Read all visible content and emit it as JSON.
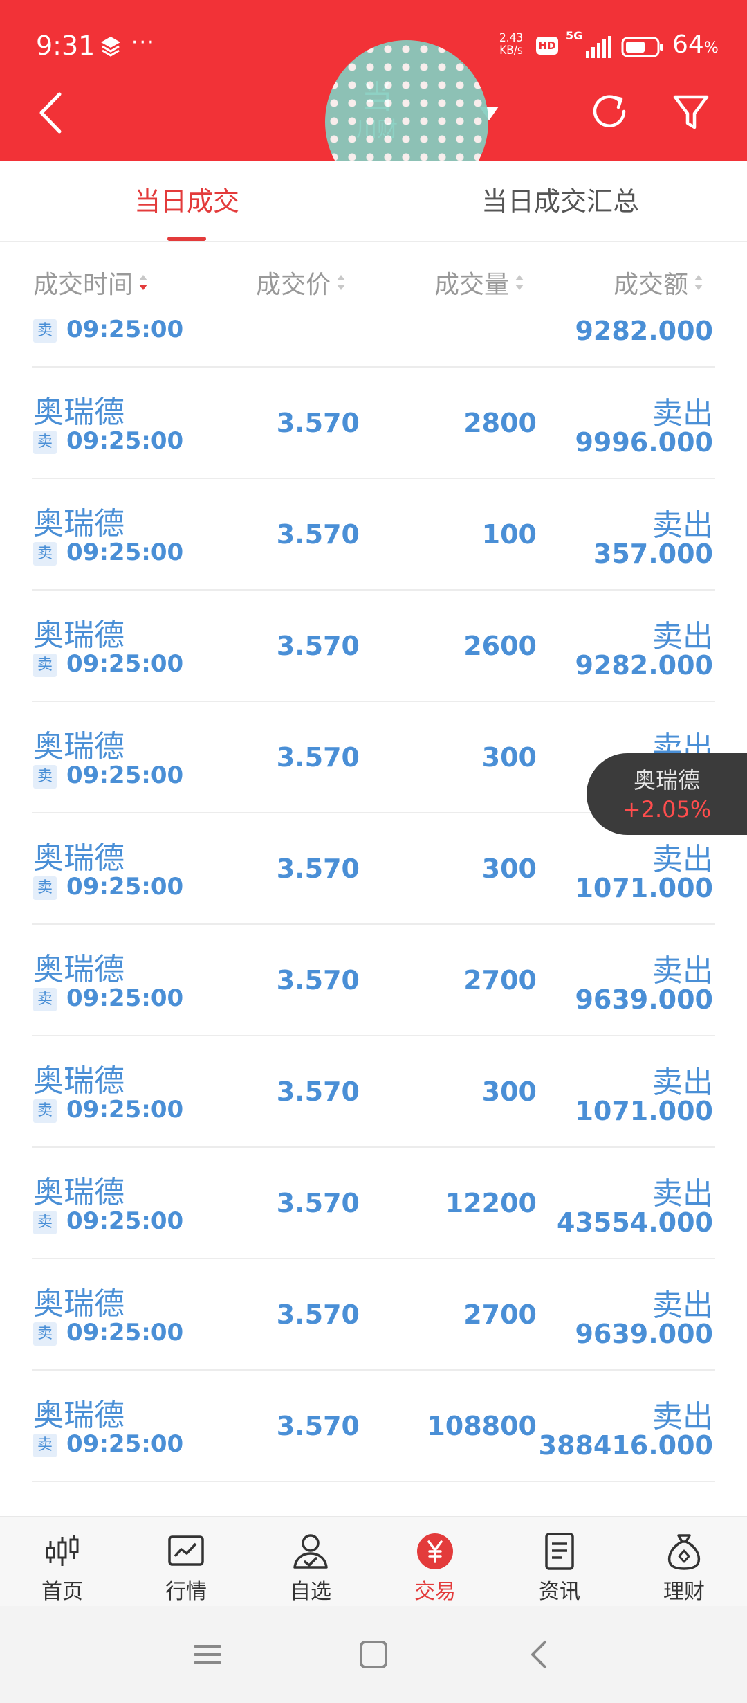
{
  "status_bar": {
    "time": "9:31",
    "dots": "···",
    "net_speed_value": "2.43",
    "net_speed_unit": "KB/s",
    "hd_badge": "HD",
    "network": "5G",
    "battery_percent": "64",
    "battery_unit": "%",
    "battery_level": 0.64
  },
  "header": {
    "title": "当",
    "subtitle": "川财",
    "background_color": "#f23237"
  },
  "tabs": [
    {
      "label": "当日成交",
      "active": true
    },
    {
      "label": "当日成交汇总",
      "active": false
    }
  ],
  "columns": {
    "time": "成交时间",
    "price": "成交价",
    "volume": "成交量",
    "amount": "成交额"
  },
  "partial_row": {
    "side": "卖",
    "time": "09:25:00",
    "amount": "9282.000"
  },
  "rows": [
    {
      "name": "奥瑞德",
      "side": "卖",
      "time": "09:25:00",
      "price": "3.570",
      "volume": "2800",
      "direction": "卖出",
      "amount": "9996.000"
    },
    {
      "name": "奥瑞德",
      "side": "卖",
      "time": "09:25:00",
      "price": "3.570",
      "volume": "100",
      "direction": "卖出",
      "amount": "357.000"
    },
    {
      "name": "奥瑞德",
      "side": "卖",
      "time": "09:25:00",
      "price": "3.570",
      "volume": "2600",
      "direction": "卖出",
      "amount": "9282.000"
    },
    {
      "name": "奥瑞德",
      "side": "卖",
      "time": "09:25:00",
      "price": "3.570",
      "volume": "300",
      "direction": "卖出",
      "amount": ""
    },
    {
      "name": "奥瑞德",
      "side": "卖",
      "time": "09:25:00",
      "price": "3.570",
      "volume": "300",
      "direction": "卖出",
      "amount": "1071.000"
    },
    {
      "name": "奥瑞德",
      "side": "卖",
      "time": "09:25:00",
      "price": "3.570",
      "volume": "2700",
      "direction": "卖出",
      "amount": "9639.000"
    },
    {
      "name": "奥瑞德",
      "side": "卖",
      "time": "09:25:00",
      "price": "3.570",
      "volume": "300",
      "direction": "卖出",
      "amount": "1071.000"
    },
    {
      "name": "奥瑞德",
      "side": "卖",
      "time": "09:25:00",
      "price": "3.570",
      "volume": "12200",
      "direction": "卖出",
      "amount": "43554.000"
    },
    {
      "name": "奥瑞德",
      "side": "卖",
      "time": "09:25:00",
      "price": "3.570",
      "volume": "2700",
      "direction": "卖出",
      "amount": "9639.000"
    },
    {
      "name": "奥瑞德",
      "side": "卖",
      "time": "09:25:00",
      "price": "3.570",
      "volume": "108800",
      "direction": "卖出",
      "amount": "388416.000"
    }
  ],
  "stock_chip": {
    "name": "奥瑞德",
    "change": "+2.05%"
  },
  "bottom_nav": [
    {
      "label": "首页",
      "icon": "candlestick-icon",
      "active": false
    },
    {
      "label": "行情",
      "icon": "chart-icon",
      "active": false
    },
    {
      "label": "自选",
      "icon": "user-check-icon",
      "active": false
    },
    {
      "label": "交易",
      "icon": "yuan-icon",
      "active": true
    },
    {
      "label": "资讯",
      "icon": "document-icon",
      "active": false
    },
    {
      "label": "理财",
      "icon": "money-bag-icon",
      "active": false
    }
  ],
  "colors": {
    "brand_red": "#f23237",
    "active_red": "#e33b3b",
    "data_blue": "#4a8fd6",
    "chip_change_red": "#ff4d4d"
  }
}
